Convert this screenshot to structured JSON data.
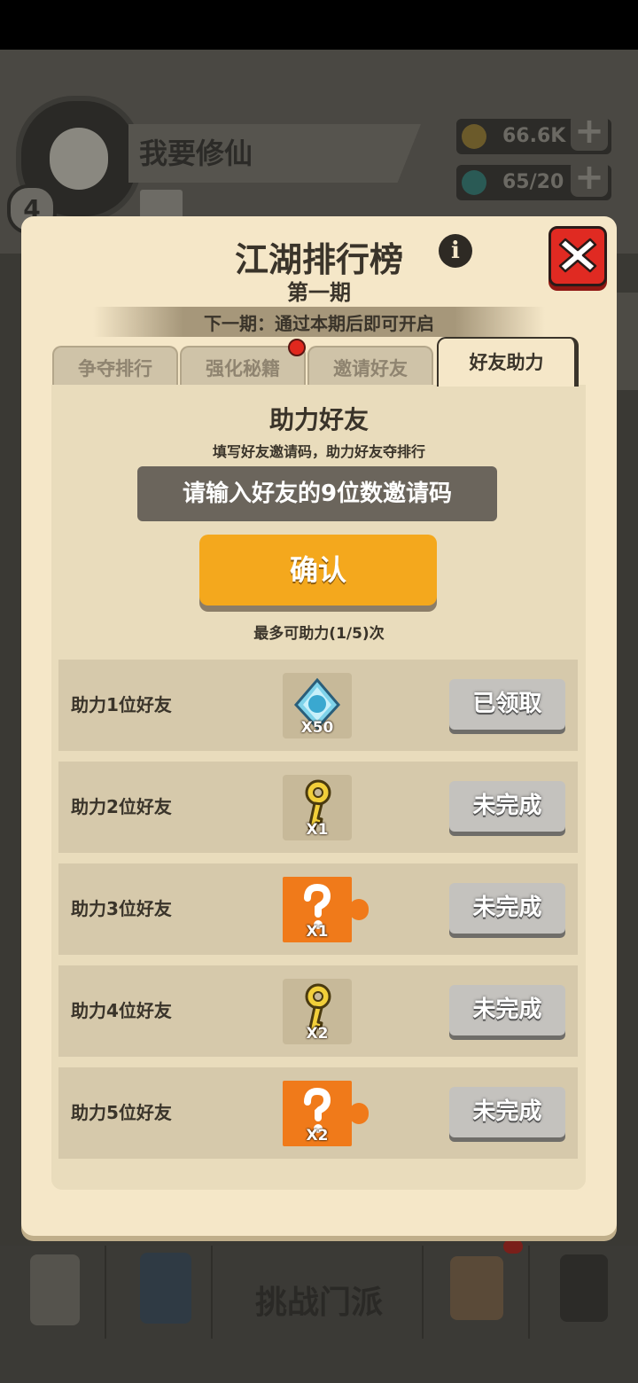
{
  "background": {
    "player_name": "我要修仙",
    "level": "4",
    "gold": "66.6K",
    "gems": "65/20",
    "plus_label": "+",
    "bottom_nav_center": "挑战门派"
  },
  "dialog": {
    "title": "江湖排行榜",
    "info_label": "i",
    "period": "第一期",
    "next_period": "下一期：通过本期后即可开启",
    "tabs": [
      {
        "label": "争夺排行",
        "active": false
      },
      {
        "label": "强化秘籍",
        "active": false,
        "has_badge": true
      },
      {
        "label": "邀请好友",
        "active": false
      },
      {
        "label": "好友助力",
        "active": true
      }
    ],
    "section_title": "助力好友",
    "section_subtitle": "填写好友邀请码，助力好友夺排行",
    "input_placeholder": "请输入好友的9位数邀请码",
    "confirm_label": "确认",
    "limit_text": "最多可助力(1/5)次",
    "rows": [
      {
        "label": "助力1位好友",
        "reward_icon": "diamond-multiplier-icon",
        "reward_qty": "X50",
        "button": "已领取"
      },
      {
        "label": "助力2位好友",
        "reward_icon": "gold-key-icon",
        "reward_qty": "X1",
        "button": "未完成"
      },
      {
        "label": "助力3位好友",
        "reward_icon": "mystery-puzzle-icon",
        "reward_qty": "X1",
        "button": "未完成"
      },
      {
        "label": "助力4位好友",
        "reward_icon": "gold-key-icon",
        "reward_qty": "X2",
        "button": "未完成"
      },
      {
        "label": "助力5位好友",
        "reward_icon": "mystery-puzzle-icon",
        "reward_qty": "X2",
        "button": "未完成"
      }
    ]
  },
  "colors": {
    "panel": "#f5e7c8",
    "confirm": "#f4a81d",
    "close": "#e02a22",
    "button_grey": "#c4c2be"
  }
}
